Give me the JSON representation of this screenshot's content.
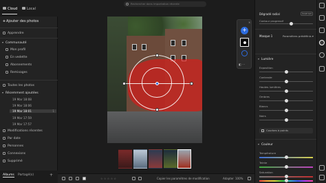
{
  "left_panel": {
    "tabs": {
      "cloud": "Cloud",
      "local": "Local"
    },
    "add_photos": "Ajouter des photos",
    "nav": {
      "learn": "Apprendre"
    },
    "community": {
      "header": "Communauté",
      "items": [
        "Mon profil",
        "En vedette",
        "Abonnements",
        "Remixages"
      ]
    },
    "all_photos": "Toutes les photos",
    "recent": {
      "header": "Récemment ajoutées",
      "items": [
        {
          "label": "19 Mar 18:08",
          "count": ""
        },
        {
          "label": "19 Mar 18:06",
          "count": ""
        },
        {
          "label": "19 Mar 18:01",
          "count": "1"
        },
        {
          "label": "19 Mar 17:59",
          "count": ""
        },
        {
          "label": "19 Mar 17:57",
          "count": ""
        }
      ]
    },
    "more": [
      "Modifications récentes",
      "Par date",
      "Personnes",
      "Connexions",
      "Supprimé"
    ],
    "bottom_tabs": {
      "albums": "Albums",
      "shared": "Partagé(s)"
    }
  },
  "center": {
    "search_placeholder": "Rechercher dans importation récente",
    "bottom_bar": {
      "copy_settings": "Copier les paramètres de modification",
      "fit": "Adapter",
      "zoom": "100%"
    }
  },
  "float_panel": {
    "close": "×",
    "add": "+"
  },
  "right_panel": {
    "radial_gradient": "Dégradé radial",
    "reset": "Inverser",
    "inner_contour": "Contour progressif",
    "mask": "Masque 1",
    "presets": "Paramètres prédéfinis",
    "light_header": "Lumière",
    "light_sliders": [
      {
        "label": "Exposition",
        "value": 0.5
      },
      {
        "label": "Contraste",
        "value": 0.5
      },
      {
        "label": "Hautes lumières",
        "value": 0.5
      },
      {
        "label": "Ombres",
        "value": 0.5
      },
      {
        "label": "Blancs",
        "value": 0.5
      },
      {
        "label": "Noirs",
        "value": 0.5
      }
    ],
    "curves_button": "Courbes à points",
    "color_header": "Couleur",
    "color_sliders": [
      {
        "label": "Température",
        "value": 0.5
      },
      {
        "label": "Teinte",
        "value": 0.5
      },
      {
        "label": "Saturation",
        "value": 0.5
      },
      {
        "label": "Teinte",
        "value": 0.5
      }
    ]
  },
  "colors": {
    "accent": "#2d6cdf",
    "mask_red": "#e61414"
  }
}
